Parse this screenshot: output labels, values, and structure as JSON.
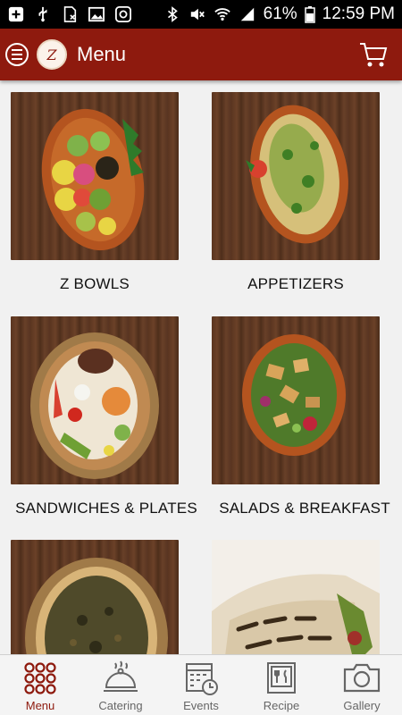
{
  "status_bar": {
    "battery": "61%",
    "time": "12:59 PM",
    "icons": [
      "add-icon",
      "usb-icon",
      "sim-icon",
      "image-icon",
      "instagram-icon",
      "bluetooth-icon",
      "mute-icon",
      "wifi-icon",
      "signal-icon",
      "battery-icon"
    ]
  },
  "app_bar": {
    "title": "Menu",
    "logo_text": "Z",
    "icons": [
      "hamburger-menu-icon",
      "logo",
      "cart-icon"
    ]
  },
  "menu_tiles": [
    {
      "label": "Z BOWLS"
    },
    {
      "label": "APPETIZERS"
    },
    {
      "label": "SANDWICHES & PLATES"
    },
    {
      "label": "SALADS & BREAKFAST"
    },
    {
      "label": ""
    },
    {
      "label": ""
    }
  ],
  "bottom_nav": [
    {
      "label": "Menu",
      "icon": "grid-dots-icon",
      "active": true
    },
    {
      "label": "Catering",
      "icon": "cloche-icon",
      "active": false
    },
    {
      "label": "Events",
      "icon": "calendar-clock-icon",
      "active": false
    },
    {
      "label": "Recipe",
      "icon": "recipe-book-icon",
      "active": false
    },
    {
      "label": "Gallery",
      "icon": "camera-icon",
      "active": false
    }
  ],
  "colors": {
    "accent": "#8e1a0e",
    "background": "#f1f1f1",
    "inactive_nav": "#666666"
  }
}
